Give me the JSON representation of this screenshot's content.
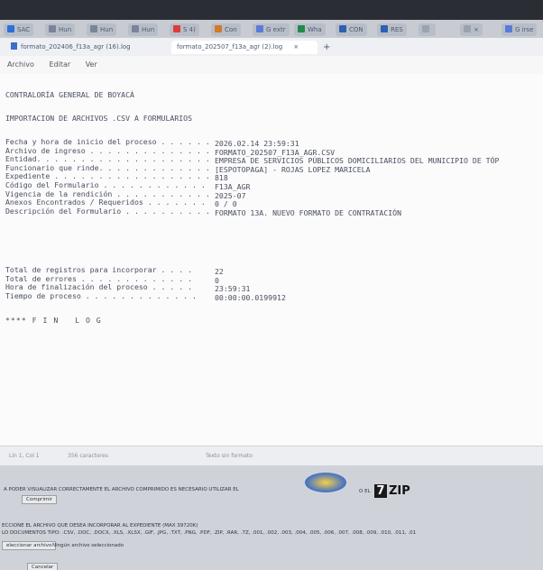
{
  "browser_tabs": [
    {
      "label": "SAC",
      "color": "#2e6fd8"
    },
    {
      "label": "Hun",
      "color": "#7a8599"
    },
    {
      "label": "Hun",
      "color": "#7a8599"
    },
    {
      "label": "Hun",
      "color": "#7a8599"
    },
    {
      "label": "S 4)",
      "color": "#e03b3b"
    },
    {
      "label": "Con",
      "color": "#d07a2a"
    },
    {
      "label": "G extr",
      "color": "#5a7bd8"
    },
    {
      "label": "Wha",
      "color": "#1f8a4c"
    },
    {
      "label": "CON",
      "color": "#2f5fb0"
    },
    {
      "label": "RES",
      "color": "#2f5fb0"
    },
    {
      "label": "",
      "color": "#9aa3b0"
    },
    {
      "label": "×",
      "color": "#9aa3b0"
    },
    {
      "label": "G irse",
      "color": "#5a7bd8"
    }
  ],
  "doc_tabs": [
    {
      "label": "formato_202406_f13a_agr (16).log"
    },
    {
      "label": "formato_202507_f13a_agr (2).log"
    }
  ],
  "doc_tab_close": "×",
  "doc_tab_add": "+",
  "menu": {
    "archivo": "Archivo",
    "editar": "Editar",
    "ver": "Ver"
  },
  "log": {
    "header1": "CONTRALORÍA GENERAL DE BOYACÁ",
    "header2": "IMPORTACION DE ARCHIVOS .CSV A FORMULARIOS",
    "fields": [
      {
        "label": "Fecha y hora de inicio del proceso . . . . . .",
        "value": "2026.02.14 23:59:31"
      },
      {
        "label": "Archivo de ingreso . . . . . . . . . . . . . .",
        "value": "FORMATO_202507_F13A_AGR.CSV"
      },
      {
        "label": "Entidad. . . . . . . . . . . . . . . . . . . .",
        "value": "EMPRESA DE SERVICIOS PÚBLICOS DOMICILIARIOS DEL MUNICIPIO DE TÓP"
      },
      {
        "label": "Funcionario que rinde. . . . . . . . . . . . .",
        "value": "[ESPOTOPAGA] - ROJAS LOPEZ MARICELA"
      },
      {
        "label": "Expediente . . . . . . . . . . . . . . . . . .",
        "value": "818"
      },
      {
        "label": "Código del Formulario . . . . . . . . . . . .",
        "value": "F13A_AGR"
      },
      {
        "label": "Vigencia de la rendición . . . . . . . . . . .",
        "value": "2025-07"
      },
      {
        "label": "Anexos Encontrados / Requeridos . . . . . . .",
        "value": "0 / 0"
      },
      {
        "label": "Descripción del Formulario . . . . . . . . . .",
        "value": "FORMATO 13A. NUEVO FORMATO DE CONTRATACIÓN"
      }
    ],
    "summary": [
      {
        "label": "Total de registros para incorporar . . . .",
        "value": "22"
      },
      {
        "label": "Total de errores . . . . . . . . . . . . .",
        "value": "0"
      },
      {
        "label": "Hora de finalización del proceso . . . . .",
        "value": "23:59:31"
      },
      {
        "label": "Tiempo de proceso . . . . . . . . . . . . .",
        "value": "00:00:00.0199912"
      }
    ],
    "end": "**** F I N   L O G"
  },
  "status": {
    "position": "Lín 1, Col 1",
    "chars": "356 caracteres",
    "format": "Texto sin formato"
  },
  "webpage": {
    "notice": "A PODER VISUALIZAR CORRECTAMENTE EL ARCHIVO COMPRIMIDO ES NECESARIO UTILIZAR EL",
    "comprimir": "Comprimir",
    "o_el": "O EL",
    "seven": "7",
    "zip": "ZIP",
    "select_line1": "ECCIONE EL ARCHIVO QUE DESEA INCORPORAR AL EXPEDIENTE (MAX 39720K)",
    "select_line2": "LO DOCUMENTOS TIPO: .CSV, .DOC, .DOCX, .XLS, .XLSX, .GIF, .JPG, .TXT, .PNG, .PDF, .ZIP, .RAR, .7Z, .001, .002, .003, .004, .005, .006, .007, .008, .009, .010, .011, .01",
    "file_button": "eleccionar archivo",
    "no_file": "Ningún archivo seleccionado",
    "bottom_button": "Cancelar"
  }
}
